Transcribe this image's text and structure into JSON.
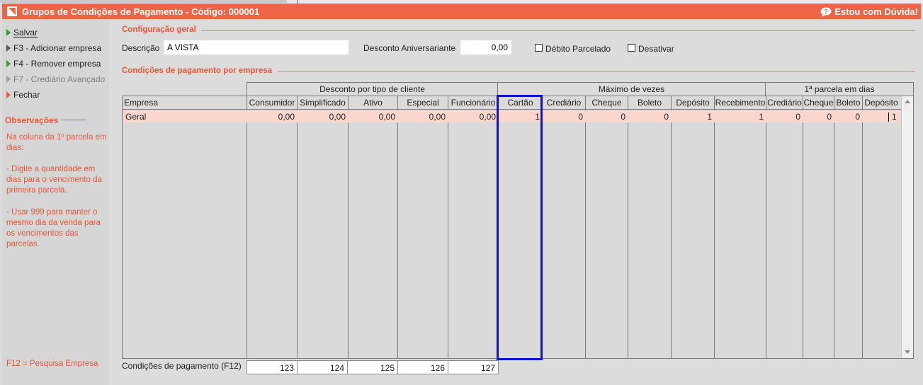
{
  "window": {
    "title": "Grupos de Condições de Pagamento - Código: 000001",
    "help_label": "Estou com Dúvida!"
  },
  "sidebar": {
    "items": [
      {
        "label": "Salvar",
        "icon": "green-arrow-icon",
        "enabled": true
      },
      {
        "label": "F3 - Adicionar empresa",
        "icon": "dark-arrow-icon",
        "enabled": true
      },
      {
        "label": "F4 - Remover empresa",
        "icon": "green-arrow-icon",
        "enabled": true
      },
      {
        "label": "F7 - Crediário Avançado",
        "icon": "gray-arrow-icon",
        "enabled": false
      },
      {
        "label": "Fechar",
        "icon": "red-arrow-icon",
        "enabled": true
      }
    ],
    "observations_title": "Observações",
    "observations": [
      "Na coluna da 1º parcela em dias:",
      "- Digite a quantidade em dias para o vencimento da primeira parcela.",
      "- Usar 999 para manter o mesmo dia da venda para os vencimentos das parcelas."
    ],
    "f12_hint": "F12 = Pesquisa Empresa"
  },
  "config": {
    "section_title": "Configuração geral",
    "descricao_label": "Descrição",
    "descricao_value": "A VISTA",
    "desconto_label": "Desconto Aniversariante",
    "desconto_value": "0,00",
    "debito_label": "Débito Parcelado",
    "debito_checked": false,
    "desativar_label": "Desativar",
    "desativar_checked": false
  },
  "grid": {
    "section_title": "Condições de pagamento por empresa",
    "groups": {
      "desconto": "Desconto por tipo de cliente",
      "maximo": "Máximo de vezes",
      "parcela": "1ª parcela em dias"
    },
    "columns": {
      "empresa": "Empresa",
      "consumidor": "Consumidor",
      "simplificado": "Simplificado",
      "ativo": "Ativo",
      "especial": "Especial",
      "funcionario": "Funcionário",
      "cartao": "Cartão",
      "crediario": "Crediário",
      "cheque": "Cheque",
      "boleto": "Boleto",
      "deposito": "Depósito",
      "recebimento": "Recebimento",
      "p_crediario": "Crediário",
      "p_cheque": "Cheque",
      "p_boleto": "Boleto",
      "p_deposito": "Depósito"
    },
    "rows": [
      {
        "empresa": "Geral",
        "consumidor": "0,00",
        "simplificado": "0,00",
        "ativo": "0,00",
        "especial": "0,00",
        "funcionario": "0,00",
        "cartao": "1",
        "crediario": "0",
        "cheque": "0",
        "boleto": "0",
        "deposito": "1",
        "recebimento": "1",
        "p_crediario": "0",
        "p_cheque": "0",
        "p_boleto": "0",
        "p_deposito": "1"
      }
    ],
    "highlighted_column": "Cartão"
  },
  "footer": {
    "label": "Condições de pagamento (F12)",
    "values": [
      "123",
      "124",
      "125",
      "126",
      "127"
    ]
  },
  "colors": {
    "accent": "#ef6347",
    "highlight_border": "#1010d0",
    "selected_row": "#f9d6ce"
  }
}
